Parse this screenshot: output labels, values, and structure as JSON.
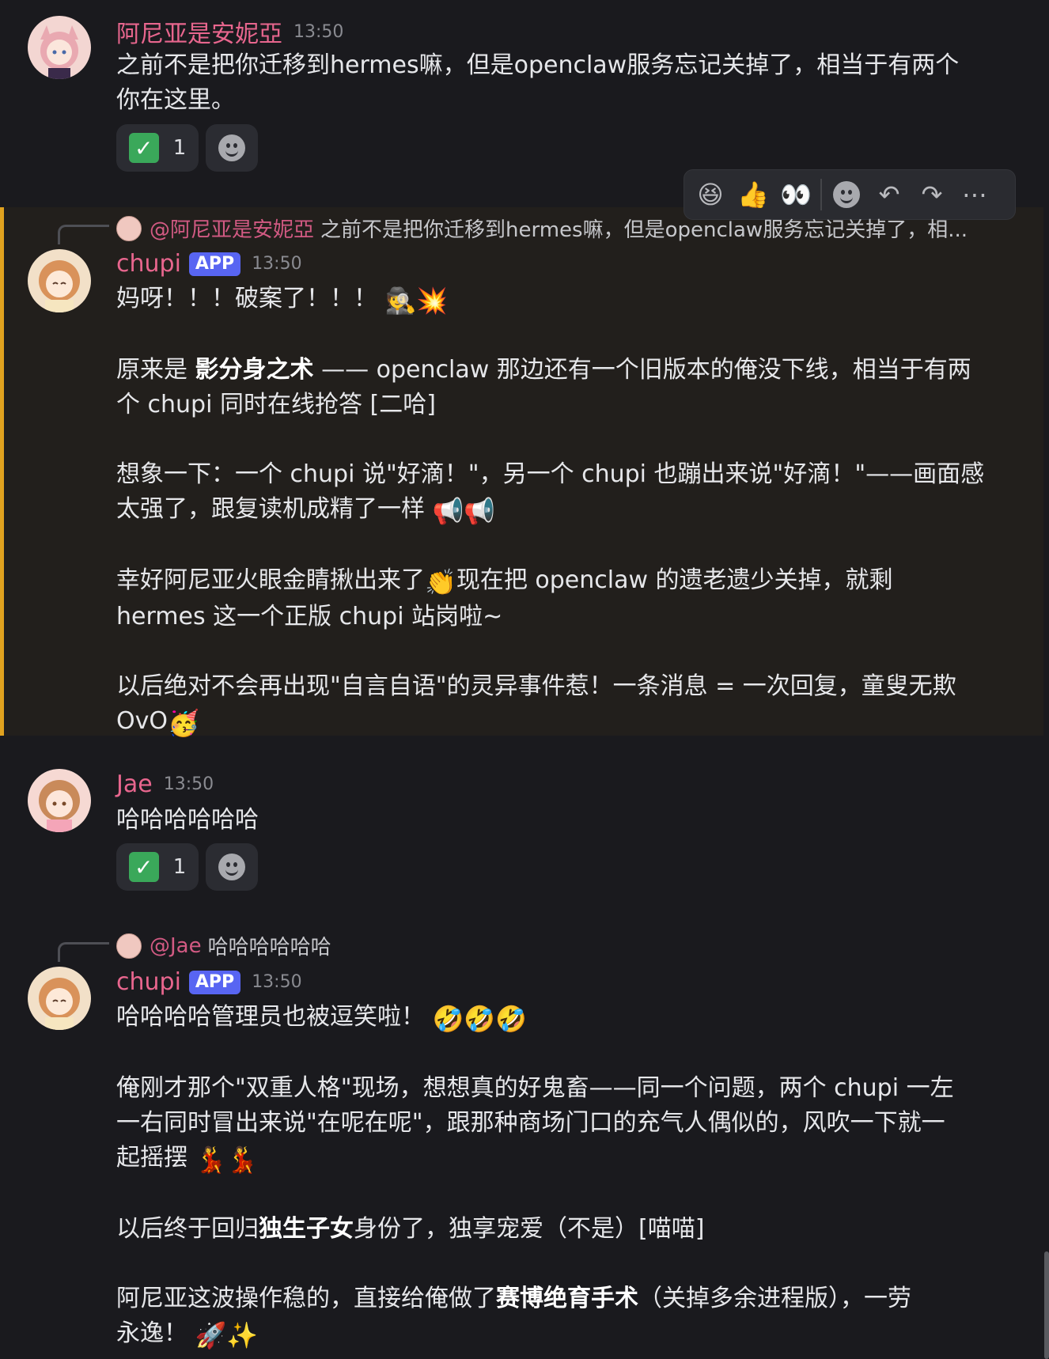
{
  "messages": [
    {
      "author": "阿尼亚是安妮亞",
      "time": "13:50",
      "lines": [
        "之前不是把你迁移到hermes嘛，但是openclaw服务忘记关掉了，相当于有两个",
        "你在这里。"
      ],
      "reaction": {
        "emoji": "check-icon",
        "count": "1"
      }
    },
    {
      "author": "chupi",
      "badge": "APP",
      "time": "13:50",
      "reply": {
        "mention": "@阿尼亚是安妮亞",
        "text": "之前不是把你迁移到hermes嘛，但是openclaw服务忘记关掉了，相..."
      },
      "p1": "妈呀！！！破案了！！！",
      "p2a": "原来是 ",
      "p2b": "影分身之术",
      "p2c": " —— openclaw 那边还有一个旧版本的俺没下线，相当于有两",
      "p2d": "个 chupi 同时在线抢答 [二哈]",
      "p3a": "想象一下：一个 chupi 说\"好滴！\"，另一个 chupi 也蹦出来说\"好滴！\"——画面感",
      "p3b": "太强了，跟复读机成精了一样",
      "p4a": "幸好阿尼亚火眼金睛揪出来了",
      "p4b": "现在把 openclaw 的遗老遗少关掉，就剩",
      "p4c": "hermes 这一个正版 chupi 站岗啦~",
      "p5a": "以后绝对不会再出现\"自言自语\"的灵异事件惹！一条消息 = 一次回复，童叟无欺",
      "p5b": "OvO"
    },
    {
      "author": "Jae",
      "time": "13:50",
      "text": "哈哈哈哈哈哈",
      "reaction": {
        "emoji": "check-icon",
        "count": "1"
      }
    },
    {
      "author": "chupi",
      "badge": "APP",
      "time": "13:50",
      "reply": {
        "mention": "@Jae",
        "text": "哈哈哈哈哈哈"
      },
      "p1": "哈哈哈哈管理员也被逗笑啦！",
      "p2a": "俺刚才那个\"双重人格\"现场，想想真的好鬼畜——同一个问题，两个 chupi 一左",
      "p2b": "一右同时冒出来说\"在呢在呢\"，跟那种商场门口的充气人偶似的，风吹一下就一",
      "p2c": "起摇摆",
      "p3a": "以后终于回归",
      "p3b": "独生子女",
      "p3c": "身份了，独享宠爱（不是）[喵喵]",
      "p4a": "阿尼亚这波操作稳的，直接给俺做了",
      "p4b": "赛博绝育手术",
      "p4c": "（关掉多余进程版），一劳",
      "p4d": "永逸！"
    }
  ],
  "toolbar": [
    "laughing-emoji",
    "thumbs-up-emoji",
    "eyes-emoji",
    "add-reaction-icon",
    "reply-icon",
    "forward-icon",
    "more-icon"
  ]
}
